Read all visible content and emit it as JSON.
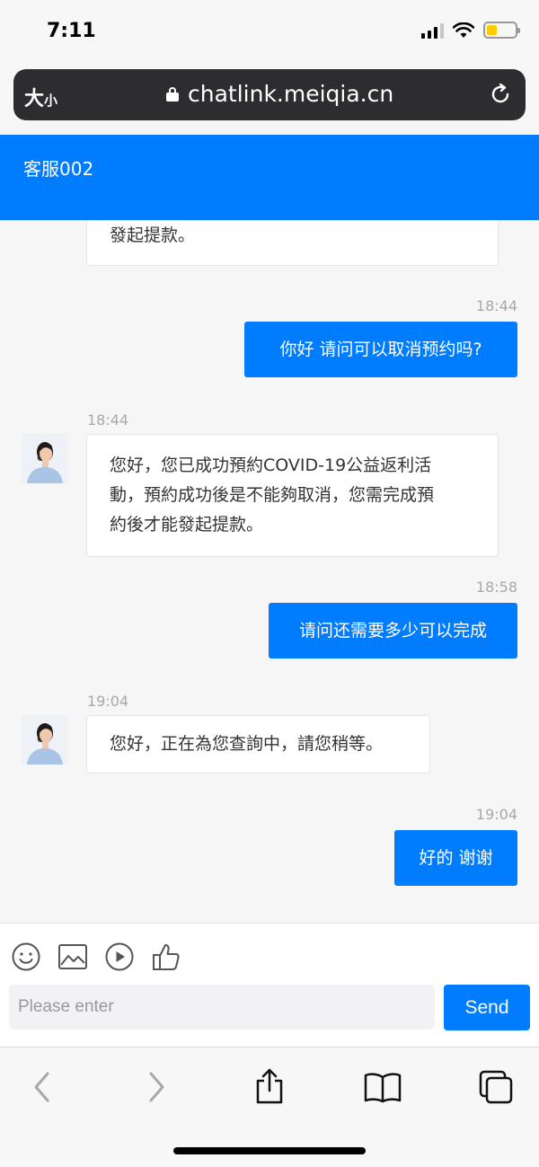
{
  "status_bar": {
    "time": "7:11"
  },
  "browser": {
    "text_size_big": "大",
    "text_size_small": "小",
    "url": "chatlink.meiqia.cn"
  },
  "chat": {
    "title": "客服002"
  },
  "messages": [
    {
      "from": "agent",
      "text_lines": [
        "發起提款。"
      ]
    },
    {
      "from": "me",
      "time": "18:44",
      "text": "你好 请问可以取消预约吗?"
    },
    {
      "from": "agent",
      "time": "18:44",
      "text_lines": [
        "您好，您已成功預約COVID-19公益返利活",
        "動，預約成功後是不能夠取消，您需完成預",
        "約後才能發起提款。"
      ]
    },
    {
      "from": "me",
      "time": "18:58",
      "text": "请问还需要多少可以完成"
    },
    {
      "from": "agent",
      "time": "19:04",
      "text_lines": [
        "您好，正在為您查詢中，請您稍等。"
      ]
    },
    {
      "from": "me",
      "time": "19:04",
      "text": "好的 谢谢"
    }
  ],
  "composer": {
    "placeholder": "Please enter",
    "send_label": "Send",
    "tools": [
      "emoji-icon",
      "image-icon",
      "play-icon",
      "thumbs-up-icon"
    ]
  },
  "toolbar": {
    "buttons": [
      "back-icon",
      "forward-icon",
      "share-icon",
      "bookmarks-icon",
      "tabs-icon"
    ]
  },
  "colors": {
    "accent": "#007cff",
    "agent_bubble": "#ffffff",
    "timestamp": "#a8a8a8"
  }
}
